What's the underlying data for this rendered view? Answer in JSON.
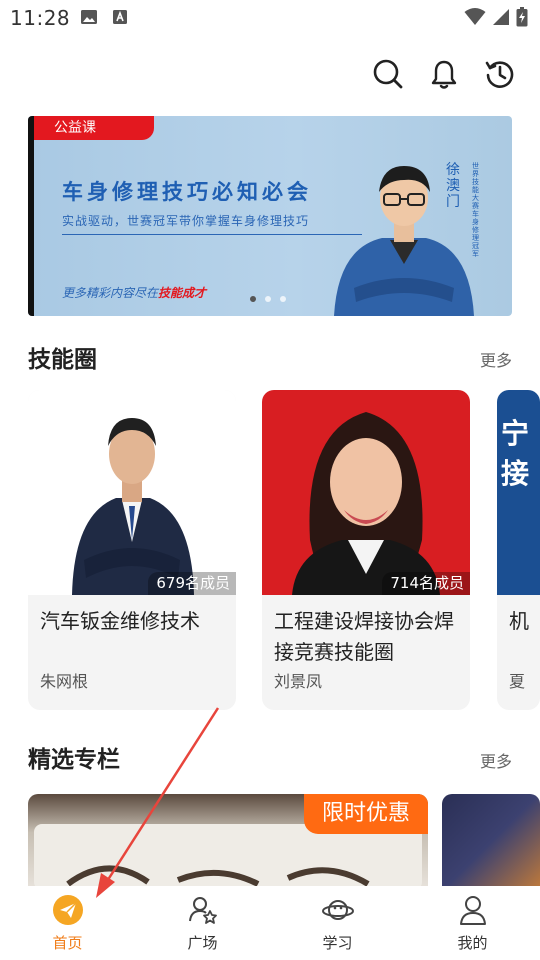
{
  "status_bar": {
    "time": "11:28",
    "icons": [
      "image-icon",
      "a-badge-icon",
      "wifi-icon",
      "signal-icon",
      "battery-charging-icon"
    ]
  },
  "top_actions": [
    "search-icon",
    "bell-icon",
    "history-clock-icon"
  ],
  "banner": {
    "tag": "公益课",
    "title": "车身修理技巧必知必会",
    "subtitle": "实战驱动，世赛冠军带你掌握车身修理技巧",
    "more_prefix": "更多精彩内容尽在",
    "more_brand": "技能成才",
    "name": "徐澳门",
    "vertical_text": "世界技能大赛车身修理冠军",
    "dots_count": 3,
    "active_dot": 0
  },
  "skill_circle": {
    "title": "技能圈",
    "more": "更多",
    "cards": [
      {
        "title": "汽车钣金维修技术",
        "owner": "朱网根",
        "members": "679名成员"
      },
      {
        "title": "工程建设焊接协会焊接竞赛技能圈",
        "owner": "刘景凤",
        "members": "714名成员"
      },
      {
        "title": "机",
        "owner": "夏",
        "photo_text": "宁接"
      }
    ]
  },
  "featured_column": {
    "title": "精选专栏",
    "more": "更多",
    "promo": "限时优惠"
  },
  "bottom_nav": [
    {
      "label": "首页",
      "icon": "paper-plane-icon",
      "active": true
    },
    {
      "label": "广场",
      "icon": "people-star-icon",
      "active": false
    },
    {
      "label": "学习",
      "icon": "planet-icon",
      "active": false
    },
    {
      "label": "我的",
      "icon": "person-icon",
      "active": false
    }
  ],
  "colors": {
    "accent": "#f07d1a",
    "banner_red": "#e3181f",
    "banner_blue": "#1f5fb3",
    "promo_orange": "#ff6a12",
    "annotation_arrow": "#e8453c"
  }
}
